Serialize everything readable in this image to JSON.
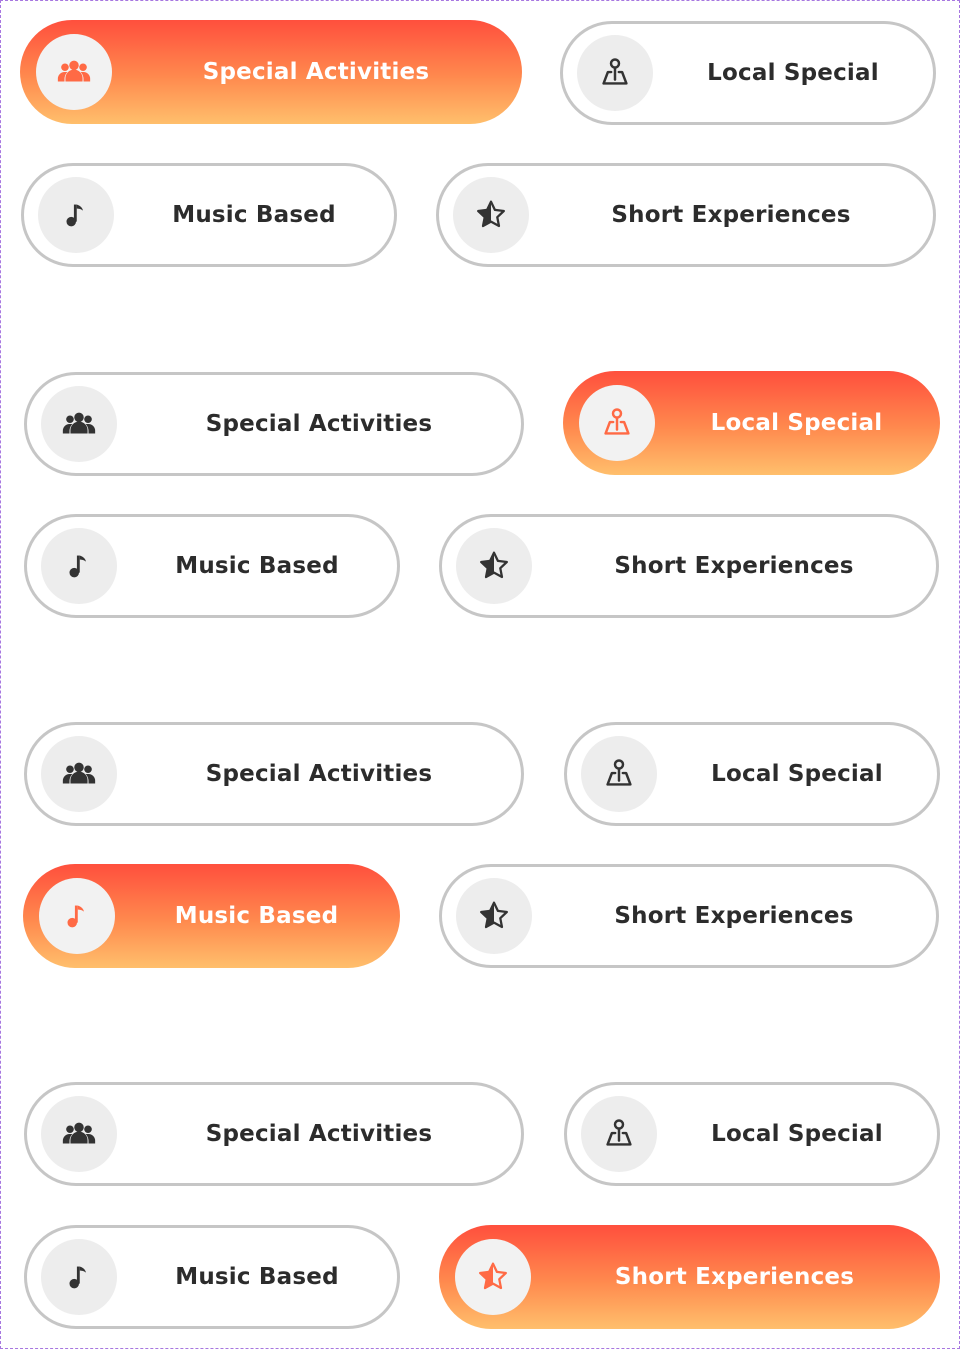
{
  "labels": {
    "special_activities": "Special Activities",
    "local_special": "Local Special",
    "music_based": "Music Based",
    "short_experiences": "Short Experiences"
  },
  "icons": {
    "special_activities": "people-group-icon",
    "local_special": "map-pin-icon",
    "music_based": "music-note-icon",
    "short_experiences": "star-icon"
  },
  "colors": {
    "active_gradient_top": "#ff4f3d",
    "active_gradient_bottom": "#ffbf6c",
    "icon_accent": "#ff6a45",
    "icon_default": "#333333",
    "chip_border": "#c6c6c6",
    "frame_border": "#a777e0"
  },
  "variants": [
    {
      "selected": "Special Activities"
    },
    {
      "selected": "Local Special"
    },
    {
      "selected": "Music Based"
    },
    {
      "selected": "Short Experiences"
    }
  ]
}
